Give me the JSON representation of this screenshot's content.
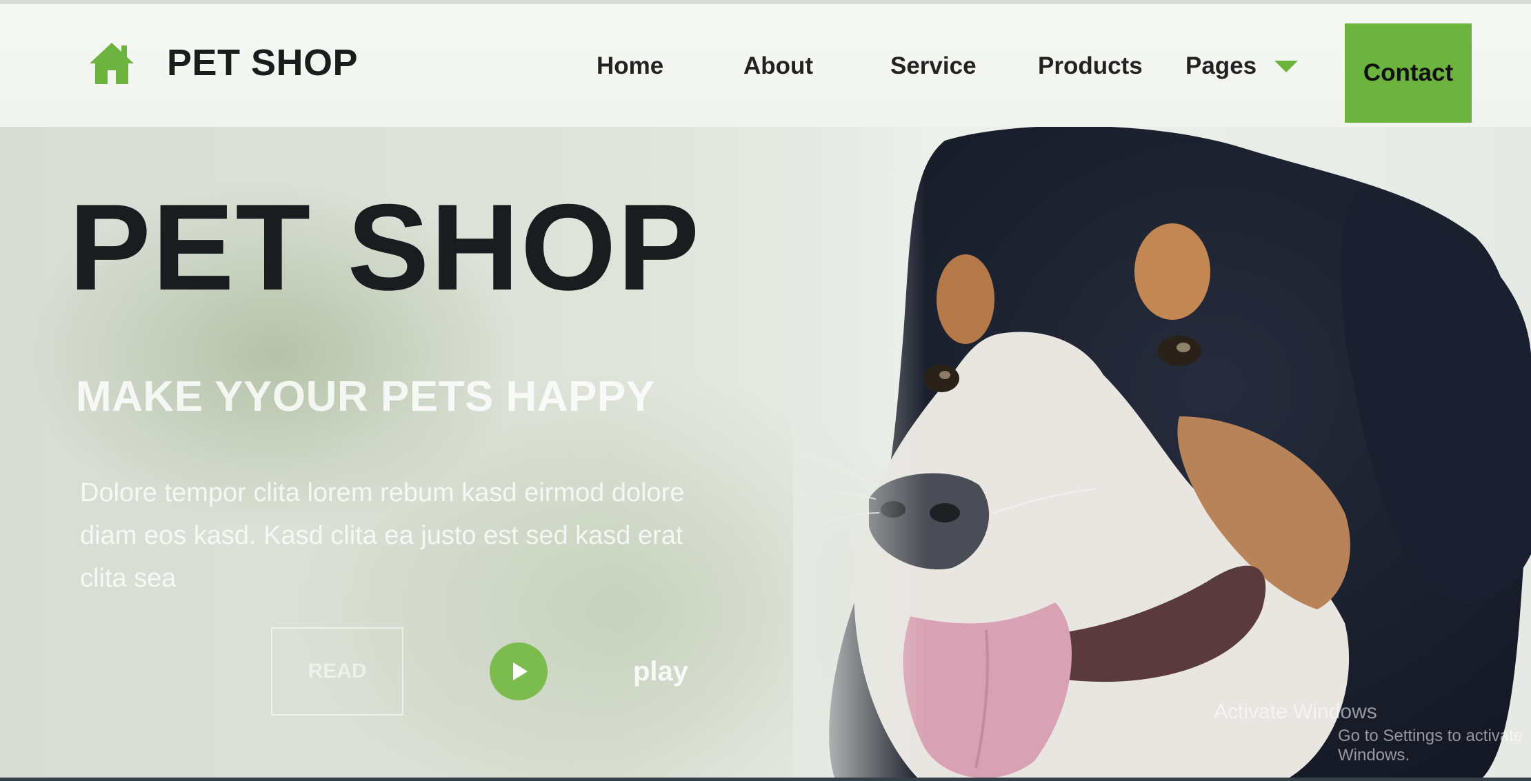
{
  "brand": {
    "title": "PET SHOP",
    "icon": "home-icon",
    "accent_color": "#6db33f"
  },
  "nav": {
    "items": [
      {
        "label": "Home"
      },
      {
        "label": "About"
      },
      {
        "label": "Service"
      },
      {
        "label": "Products"
      },
      {
        "label": "Pages"
      }
    ],
    "contact_label": "Contact"
  },
  "hero": {
    "title": "PET SHOP",
    "subtitle": "MAKE YYOUR PETS HAPPY",
    "paragraph": "Dolore tempor clita lorem rebum kasd eirmod dolore diam eos kasd. Kasd clita ea justo est sed kasd erat clita sea",
    "read_label": "READ",
    "play_label": "play",
    "play_icon": "play-icon"
  },
  "watermark": {
    "line1": "Activate Windows",
    "line2": "Go to Settings to activate Windows."
  }
}
